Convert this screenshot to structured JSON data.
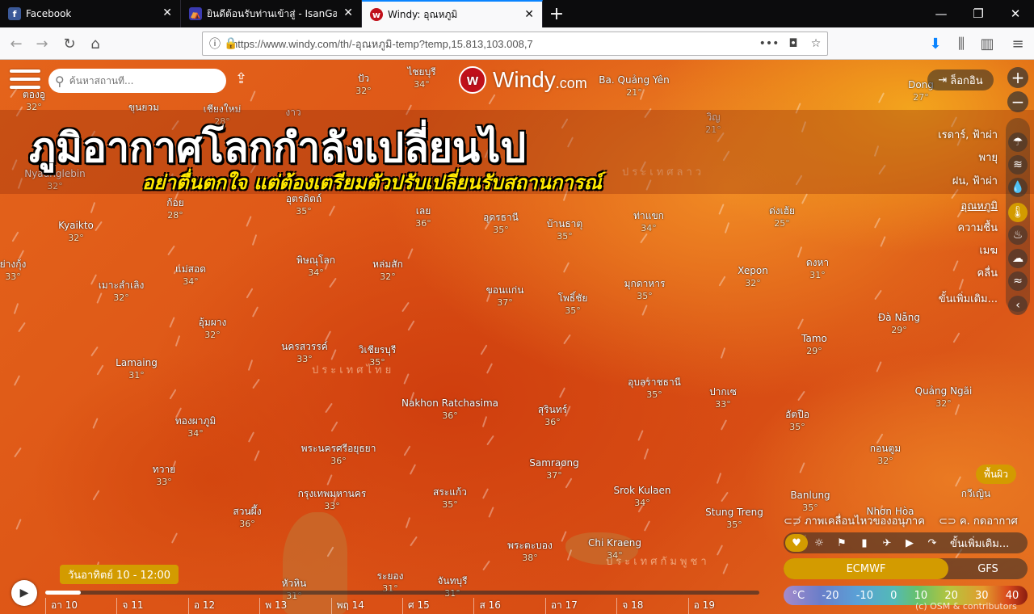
{
  "browser": {
    "tabs": [
      {
        "title": "Facebook",
        "icon": "facebook-icon",
        "active": false
      },
      {
        "title": "ยินดีต้อนรับท่านเข้าสู่ - IsanGate :",
        "icon": "isangate-icon",
        "active": false
      },
      {
        "title": "Windy: อุณหภูมิ",
        "icon": "windy-icon",
        "active": true
      }
    ],
    "url": "https://www.windy.com/th/-อุณหภูมิ-temp?temp,15.813,103.008,7",
    "url_menu": "•••"
  },
  "search": {
    "placeholder": "ค้นหาสถานที่..."
  },
  "logo": {
    "brand": "Windy",
    "domain": ".com"
  },
  "login_label": "ล็อกอิน",
  "headline": "ภูมิอากาศโลกกำลังเปลี่ยนไป",
  "subheadline": "อย่าตื่นตกใจ แต่ต้องเตรียมตัวปรับเปลี่ยนรับสถานการณ์",
  "layers": [
    {
      "label": "เรดาร์, ฟ้าผ่า",
      "icon": "radar-icon"
    },
    {
      "label": "พายุ",
      "icon": "wind-icon"
    },
    {
      "label": "ฝน, ฟ้าผ่า",
      "icon": "rain-icon"
    },
    {
      "label": "อุณหภูมิ",
      "icon": "thermometer-icon",
      "active": true
    },
    {
      "label": "ความชื้น",
      "icon": "humidity-icon"
    },
    {
      "label": "เมฆ",
      "icon": "cloud-icon"
    },
    {
      "label": "คลื่น",
      "icon": "waves-icon"
    },
    {
      "label": "ขั้นเพิ่มเติม...",
      "icon": "chevron-left-icon"
    }
  ],
  "surface_label": "พื้นผิว",
  "animation_toggle": "ภาพเคลื่อนไหวของอนุภาค",
  "isolines_toggle": "ค. กดอากาศ",
  "favorites_more": "ขั้นเพิ่มเติม...",
  "models": [
    "ECMWF",
    "GFS"
  ],
  "legend": {
    "unit": "°C",
    "values": [
      "-20",
      "-10",
      "0",
      "10",
      "20",
      "30",
      "40"
    ]
  },
  "attribution": "(c) OSM & contributors",
  "timeline": {
    "current": "วันอาทิตย์ 10 - 12:00",
    "progress": 0.05,
    "days": [
      "อา 10",
      "จ 11",
      "อ 12",
      "พ 13",
      "พฤ 14",
      "ศ 15",
      "ส 16",
      "อา 17",
      "จ 18",
      "อ 19"
    ]
  },
  "countries": [
    "ประเทศลาว",
    "ประเทศไทย",
    "ประเทศกัมพูชา"
  ],
  "cities": [
    {
      "name": "ตองอู",
      "temp": "32°"
    },
    {
      "name": "ขุนยวม",
      "temp": ""
    },
    {
      "name": "เชียงใหม่",
      "temp": "28°"
    },
    {
      "name": "งาว",
      "temp": ""
    },
    {
      "name": "ปัว",
      "temp": "32°"
    },
    {
      "name": "ไชยบุรี",
      "temp": "34°"
    },
    {
      "name": "Ba. Quảng Yên",
      "temp": "21°"
    },
    {
      "name": "วิญ",
      "temp": "21°"
    },
    {
      "name": "Dong",
      "temp": "27°"
    },
    {
      "name": "Nyaunglebin",
      "temp": "32°"
    },
    {
      "name": "ก้อย",
      "temp": "28°"
    },
    {
      "name": "อุตรดิตถ์",
      "temp": "35°"
    },
    {
      "name": "เลย",
      "temp": "36°"
    },
    {
      "name": "อุดรธานี",
      "temp": "35°"
    },
    {
      "name": "บ้านธาตุ",
      "temp": "35°"
    },
    {
      "name": "ท่าแขก",
      "temp": "34°"
    },
    {
      "name": "ด่งเฮ้ย",
      "temp": "25°"
    },
    {
      "name": "Kyaikto",
      "temp": "32°"
    },
    {
      "name": "ย่างกุ้ง",
      "temp": "33°"
    },
    {
      "name": "แม่สอด",
      "temp": "34°"
    },
    {
      "name": "พิษณุโลก",
      "temp": "34°"
    },
    {
      "name": "หล่มสัก",
      "temp": "32°"
    },
    {
      "name": "ขอนแก่น",
      "temp": "37°"
    },
    {
      "name": "โพธิ์ชัย",
      "temp": "35°"
    },
    {
      "name": "มุกดาหาร",
      "temp": "35°"
    },
    {
      "name": "Xepon",
      "temp": "32°"
    },
    {
      "name": "ดงหา",
      "temp": "31°"
    },
    {
      "name": "เมาะลำเลิง",
      "temp": "32°"
    },
    {
      "name": "อุ้มผาง",
      "temp": "32°"
    },
    {
      "name": "Đà Nẵng",
      "temp": "29°"
    },
    {
      "name": "Lamaing",
      "temp": "31°"
    },
    {
      "name": "นครสวรรค์",
      "temp": "33°"
    },
    {
      "name": "วิเชียรบุรี",
      "temp": "35°"
    },
    {
      "name": "Tamo",
      "temp": "29°"
    },
    {
      "name": "อุบลราชธานี",
      "temp": "35°"
    },
    {
      "name": "ปากเซ",
      "temp": "33°"
    },
    {
      "name": "Nakhon Ratchasima",
      "temp": "36°"
    },
    {
      "name": "Quảng Ngãi",
      "temp": "32°"
    },
    {
      "name": "ทองผาภูมิ",
      "temp": "34°"
    },
    {
      "name": "สุรินทร์",
      "temp": "36°"
    },
    {
      "name": "อัตปือ",
      "temp": "35°"
    },
    {
      "name": "ทวาย",
      "temp": "33°"
    },
    {
      "name": "พระนครศรีอยุธยา",
      "temp": "36°"
    },
    {
      "name": "Samraong",
      "temp": "37°"
    },
    {
      "name": "กอนตูม",
      "temp": "32°"
    },
    {
      "name": "กรุงเทพมหานคร",
      "temp": "33°"
    },
    {
      "name": "สระแก้ว",
      "temp": "35°"
    },
    {
      "name": "Srok Kulaen",
      "temp": "34°"
    },
    {
      "name": "Banlung",
      "temp": "35°"
    },
    {
      "name": "Nhơn Hòa",
      "temp": ""
    },
    {
      "name": "กวีเญิน",
      "temp": ""
    },
    {
      "name": "สวนผึ้ง",
      "temp": "36°"
    },
    {
      "name": "Stung Treng",
      "temp": "35°"
    },
    {
      "name": "พระตะบอง",
      "temp": "38°"
    },
    {
      "name": "Chi Kraeng",
      "temp": "34°"
    },
    {
      "name": "หัวหิน",
      "temp": "31°"
    },
    {
      "name": "ระยอง",
      "temp": "31°"
    },
    {
      "name": "จันทบุรี",
      "temp": "31°"
    }
  ]
}
